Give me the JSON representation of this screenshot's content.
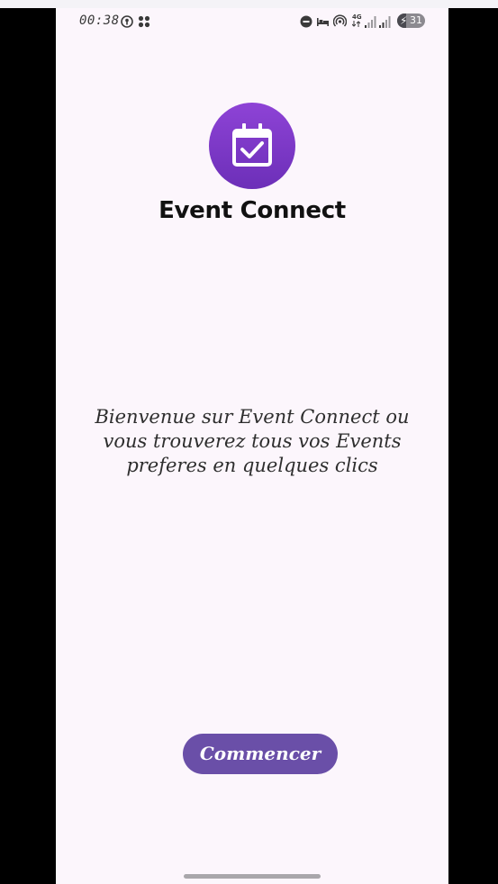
{
  "status_bar": {
    "time": "00:38",
    "battery_level": "31",
    "battery_percent": 0.31,
    "network_label": "4G",
    "icons": [
      "vpn-key-icon",
      "app-grid-icon",
      "do-not-disturb-icon",
      "bed-icon",
      "hotspot-icon",
      "network-4g-icon",
      "signal-bars-icon",
      "signal-bars-icon",
      "battery-charging-icon"
    ]
  },
  "logo": {
    "icon": "calendar-check-icon",
    "gradient_top": "#8e43d6",
    "gradient_bottom": "#6c2fb8"
  },
  "app_title": "Event Connect",
  "welcome_text": "Bienvenue sur Event Connect ou vous trouverez tous vos Events preferes en quelques clics",
  "start_button": {
    "label": "Commencer",
    "color": "#6a4fa8"
  },
  "colors": {
    "background": "#fcf6fc",
    "accent": "#6a4fa8"
  }
}
